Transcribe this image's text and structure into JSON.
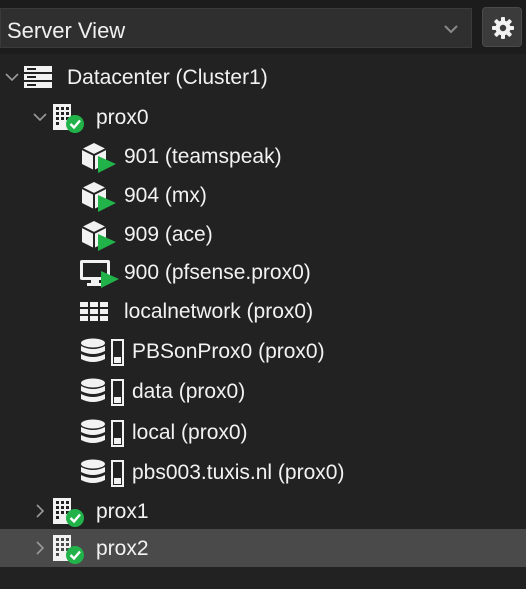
{
  "header": {
    "view_selector_value": "Server View"
  },
  "tree": {
    "datacenter": "Datacenter (Cluster1)",
    "nodes": [
      {
        "label": "prox0",
        "status": "online",
        "expanded": true,
        "children": [
          {
            "label": "901 (teamspeak)",
            "type": "container",
            "status": "running"
          },
          {
            "label": "904 (mx)",
            "type": "container",
            "status": "running"
          },
          {
            "label": "909 (ace)",
            "type": "container",
            "status": "running"
          },
          {
            "label": "900 (pfsense.prox0)",
            "type": "vm",
            "status": "running"
          },
          {
            "label": "localnetwork (prox0)",
            "type": "sdn-zone"
          },
          {
            "label": "PBSonProx0 (prox0)",
            "type": "storage"
          },
          {
            "label": "data (prox0)",
            "type": "storage"
          },
          {
            "label": "local (prox0)",
            "type": "storage"
          },
          {
            "label": "pbs003.tuxis.nl (prox0)",
            "type": "storage"
          }
        ]
      },
      {
        "label": "prox1",
        "status": "online",
        "expanded": false
      },
      {
        "label": "prox2",
        "status": "online",
        "expanded": false,
        "selected": true
      }
    ]
  },
  "colors": {
    "background": "#222222",
    "selected_row": "#4a4a4a",
    "status_green": "#21b34a",
    "icon_white": "#f2f2f2"
  }
}
